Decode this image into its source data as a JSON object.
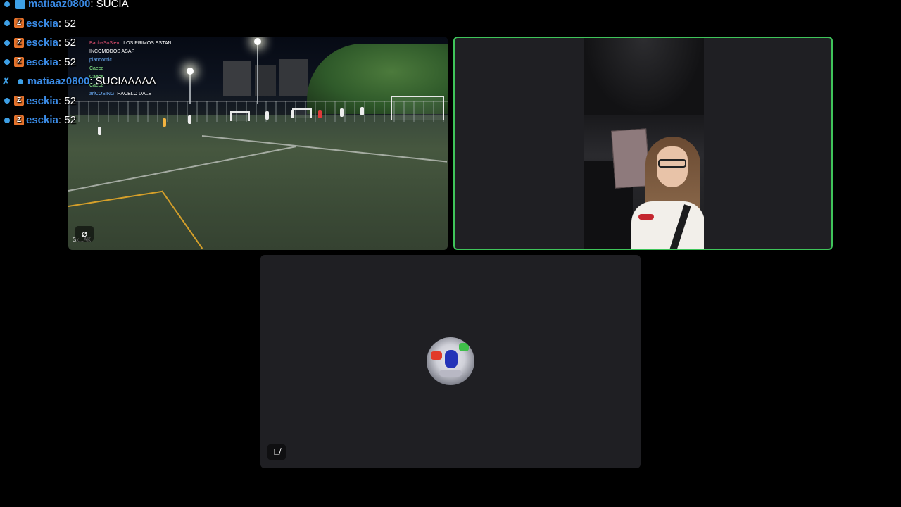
{
  "chat": {
    "messages": [
      {
        "user": "matiaaz0800",
        "text": ": SUCIA",
        "partial": true
      },
      {
        "user": "esckia",
        "text": ": 52"
      },
      {
        "user": "esckia",
        "text": ": 52"
      },
      {
        "user": "esckia",
        "text": ": 52"
      },
      {
        "user": "matiaaz0800",
        "text": ": SUCIAAAAA"
      },
      {
        "user": "esckia",
        "text": ": 52"
      },
      {
        "user": "esckia",
        "text": ": 52"
      }
    ]
  },
  "tiles": {
    "field": {
      "overlay_chat": [
        {
          "user": "BachaSoSiem",
          "text": ": LOS PRIMOS ESTAN"
        },
        {
          "user": "",
          "text": "INCOMODOS ASAP"
        },
        {
          "user": "pianoomic",
          "text": ""
        },
        {
          "user": "Caece",
          "text": ""
        },
        {
          "user": "Caece",
          "text": ""
        },
        {
          "user": "Caece",
          "text": ""
        },
        {
          "user": "ariCOSING",
          "text": ": HACELO DALE"
        }
      ],
      "label": "Sк...AK",
      "status_icon": "camera-off-icon"
    },
    "cam": {
      "speaking": true,
      "border_color": "#3fc45a"
    },
    "avatar": {
      "status_icon": "mic-off-icon"
    }
  }
}
